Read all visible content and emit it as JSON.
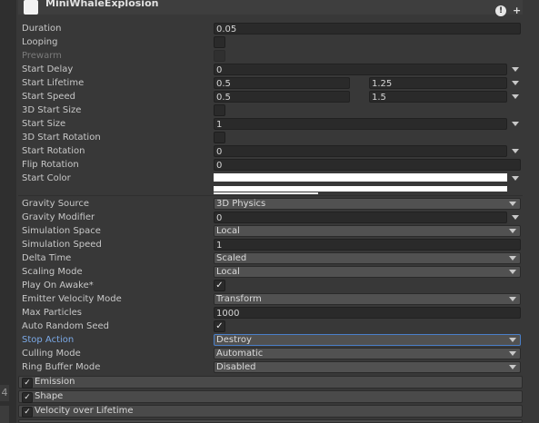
{
  "header": {
    "title": "MiniWhaleExplosion",
    "help_icon": "help-icon",
    "plus_icon": "plus-icon"
  },
  "gutter": {
    "number": "4"
  },
  "properties": {
    "duration": {
      "label": "Duration",
      "value": "0.05"
    },
    "looping": {
      "label": "Looping",
      "checked": false
    },
    "prewarm": {
      "label": "Prewarm",
      "checked": false
    },
    "start_delay": {
      "label": "Start Delay",
      "value": "0"
    },
    "start_lifetime": {
      "label": "Start Lifetime",
      "min": "0.5",
      "max": "1.25"
    },
    "start_speed": {
      "label": "Start Speed",
      "min": "0.5",
      "max": "1.5"
    },
    "start_size_3d": {
      "label": "3D Start Size",
      "checked": false
    },
    "start_size": {
      "label": "Start Size",
      "value": "1"
    },
    "start_rotation_3d": {
      "label": "3D Start Rotation",
      "checked": false
    },
    "start_rotation": {
      "label": "Start Rotation",
      "value": "0"
    },
    "flip_rotation": {
      "label": "Flip Rotation",
      "value": "0"
    },
    "start_color": {
      "label": "Start Color",
      "color": "#ffffff"
    },
    "gravity_source": {
      "label": "Gravity Source",
      "value": "3D Physics"
    },
    "gravity_modifier": {
      "label": "Gravity Modifier",
      "value": "0"
    },
    "simulation_space": {
      "label": "Simulation Space",
      "value": "Local"
    },
    "simulation_speed": {
      "label": "Simulation Speed",
      "value": "1"
    },
    "delta_time": {
      "label": "Delta Time",
      "value": "Scaled"
    },
    "scaling_mode": {
      "label": "Scaling Mode",
      "value": "Local"
    },
    "play_on_awake": {
      "label": "Play On Awake*",
      "checked": true
    },
    "emitter_velocity_mode": {
      "label": "Emitter Velocity Mode",
      "value": "Transform"
    },
    "max_particles": {
      "label": "Max Particles",
      "value": "1000"
    },
    "auto_random_seed": {
      "label": "Auto Random Seed",
      "checked": true
    },
    "stop_action": {
      "label": "Stop Action",
      "value": "Destroy"
    },
    "culling_mode": {
      "label": "Culling Mode",
      "value": "Automatic"
    },
    "ring_buffer_mode": {
      "label": "Ring Buffer Mode",
      "value": "Disabled"
    }
  },
  "modules": [
    {
      "label": "Emission",
      "checked": true
    },
    {
      "label": "Shape",
      "checked": true
    },
    {
      "label": "Velocity over Lifetime",
      "checked": true
    }
  ],
  "checkmark": "✓",
  "accent": "#4a7fc8"
}
